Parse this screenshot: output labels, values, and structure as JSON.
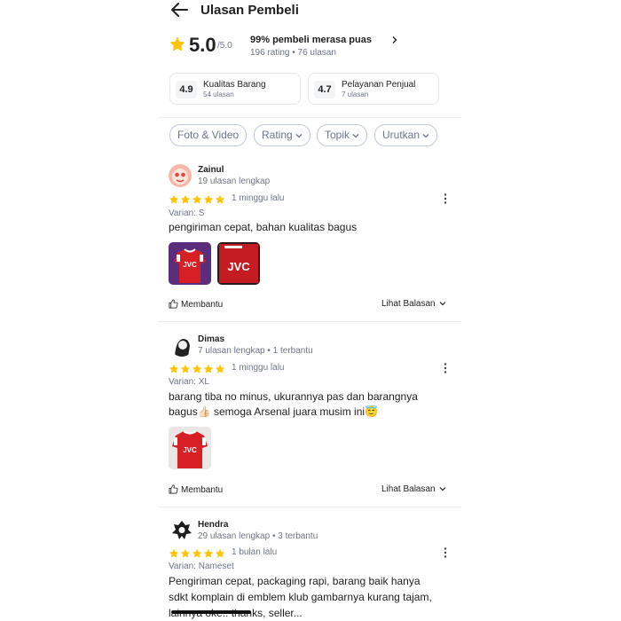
{
  "header": {
    "title": "Ulasan Pembeli"
  },
  "summary": {
    "score": "5.0",
    "score_max": "/5.0",
    "satisfied": "99% pembeli merasa puas",
    "counts": "196 rating • 76 ulasan"
  },
  "cards": [
    {
      "value": "4.9",
      "label": "Kualitas Barang",
      "sub": "54 ulasan"
    },
    {
      "value": "4.7",
      "label": "Pelayanan Penjual",
      "sub": "7 ulasan"
    }
  ],
  "filters": [
    "Foto & Video",
    "Rating",
    "Topik",
    "Urutkan"
  ],
  "reviews": [
    {
      "name": "Zainul",
      "meta": "19 ulasan lengkap",
      "time": "1 minggu lalu",
      "variant": "Varian: S",
      "text": "pengiriman cepat, bahan kualitas bagus",
      "helpful": "Membantu",
      "replies": "Lihat Balasan"
    },
    {
      "name": "Dimas",
      "meta": "7 ulasan lengkap • 1 terbantu",
      "time": "1 minggu lalu",
      "variant": "Varian: XL",
      "text_line1": "barang tiba no minus, ukurannya pas dan barangnya",
      "text_line2": "bagus👍🏻 semoga Arsenal juara musim ini😇",
      "helpful": "Membantu",
      "replies": "Lihat Balasan"
    },
    {
      "name": "Hendra",
      "meta": "29 ulasan lengkap • 3 terbantu",
      "time": "1 bulan lalu",
      "variant": "Varian: Nameset",
      "text_line1": "Pengiriman cepat, packaging rapi, barang baik hanya",
      "text_line2": "sdkt komplain di emblem klub gambarnya kurang tajam,",
      "text_line3": "lainnya oke.. thanks, seller..."
    }
  ],
  "photo_print": "JVC",
  "colors": {
    "star": "#ffc400",
    "text": "#212121",
    "muted": "#6d7588",
    "jersey": "#d71f26"
  },
  "icons": [
    "back-arrow-icon",
    "star-icon",
    "chevron-right-icon",
    "chevron-down-icon",
    "kebab-icon",
    "thumbs-up-icon"
  ]
}
